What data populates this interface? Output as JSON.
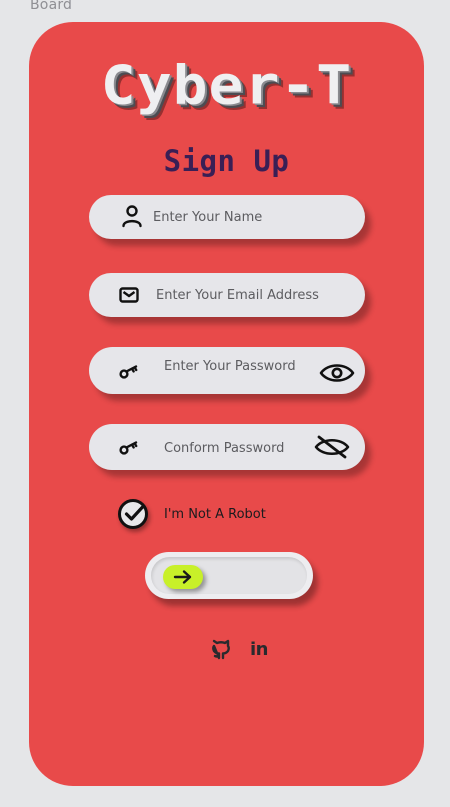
{
  "board_label": "Board",
  "app": {
    "title": "Cyber-T",
    "subtitle": "Sign Up"
  },
  "form": {
    "name": {
      "placeholder": "Enter Your Name",
      "value": "",
      "icon": "user-icon"
    },
    "email": {
      "placeholder": "Enter Your Email Address",
      "value": "",
      "icon": "mail-icon"
    },
    "password": {
      "placeholder": "Enter Your Password",
      "value": "",
      "icon": "key-icon",
      "toggle_icon": "eye-icon"
    },
    "confirm_password": {
      "placeholder": "Conform Password",
      "value": "",
      "icon": "key-icon",
      "toggle_icon": "eye-off-icon"
    }
  },
  "captcha": {
    "label": "I'm Not A Robot",
    "checked": true,
    "icon": "check-circle-icon"
  },
  "submit": {
    "icon": "arrow-right-icon",
    "accent": "#c8f029"
  },
  "social": [
    {
      "name": "github",
      "icon": "github-icon"
    },
    {
      "name": "linkedin",
      "label": "in",
      "icon": "linkedin-icon"
    }
  ],
  "colors": {
    "background": "#e5e6e8",
    "card": "#e84a4a",
    "field": "#e6e6ea",
    "subtitle": "#3a1f55"
  }
}
